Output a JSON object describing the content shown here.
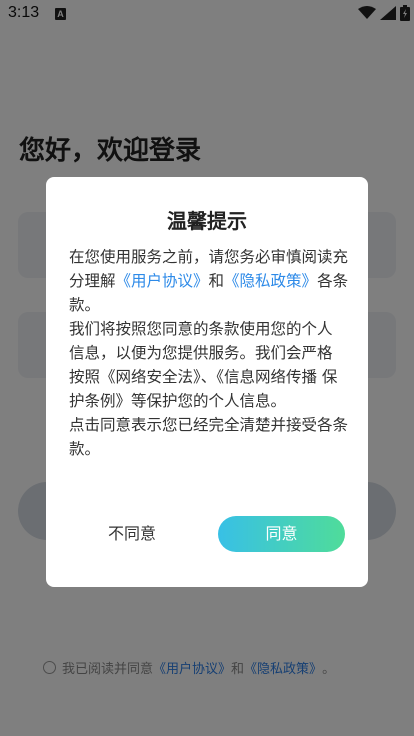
{
  "status_bar": {
    "time": "3:13",
    "notification_icon": "A"
  },
  "page": {
    "welcome": "您好，欢迎登录",
    "agreement_prefix": "我已阅读并同意",
    "agreement_user": "《用户协议》",
    "agreement_and": "和",
    "agreement_privacy": "《隐私政策》",
    "agreement_suffix": "。"
  },
  "dialog": {
    "title": "温馨提示",
    "para1_pre": "在您使用服务之前，请您务必审慎阅读充分理解",
    "para1_user": "《用户协议》",
    "para1_and": "和",
    "para1_privacy": "《隐私政策》",
    "para1_post": "各条款。",
    "para2": " 我们将按照您同意的条款使用您的个人 信息，以便为您提供服务。我们会严格 按照《网络安全法》、《信息网络传播 保护条例》等保护您的个人信息。",
    "para3": " 点击同意表示您已经完全清楚并接受各条款。",
    "disagree": "不同意",
    "agree": "同意"
  },
  "colors": {
    "link": "#2d8ae8",
    "agree_gradient_start": "#38c0e6",
    "agree_gradient_end": "#4fdc9a"
  }
}
